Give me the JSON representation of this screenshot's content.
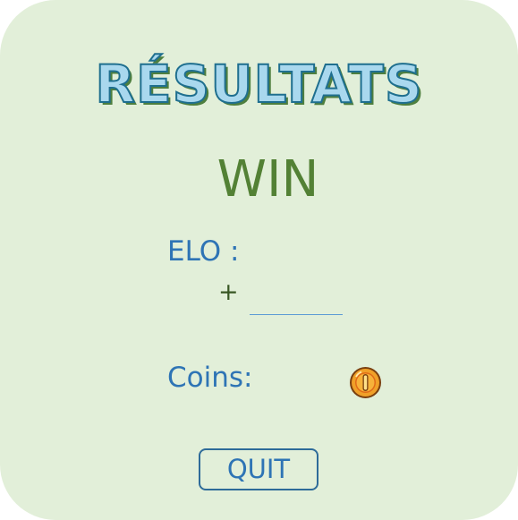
{
  "title": "RÉSULTATS",
  "result": "WIN",
  "elo": {
    "label": "ELO :",
    "sign": "+",
    "value": ""
  },
  "coins": {
    "label": "Coins:",
    "icon": "coin-icon"
  },
  "quit_label": "QUIT",
  "colors": {
    "background": "#e2efd9",
    "title_fill": "#a9d8ee",
    "title_outline": "#1f6f8f",
    "result": "#538135",
    "labels": "#2e74b5",
    "coin": "#f0a028"
  }
}
